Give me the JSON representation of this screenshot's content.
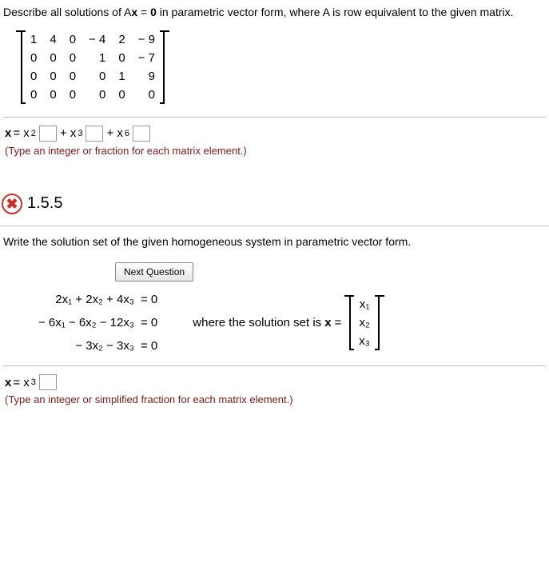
{
  "q1": {
    "prompt_pre": "Describe all solutions of A",
    "prompt_bold_x": "x",
    "prompt_eq": " = ",
    "prompt_bold_0": "0",
    "prompt_post": " in parametric vector form, where A is row equivalent to the given matrix.",
    "matrix": [
      [
        "1",
        "4",
        "0",
        "− 4",
        "2",
        "− 9"
      ],
      [
        "0",
        "0",
        "0",
        "1",
        "0",
        "− 7"
      ],
      [
        "0",
        "0",
        "0",
        "0",
        "1",
        "9"
      ],
      [
        "0",
        "0",
        "0",
        "0",
        "0",
        "0"
      ]
    ],
    "ans_x": "x",
    "ans_eq": " = x",
    "s2": "2",
    "plus": " + x",
    "s3": "3",
    "s6": "6",
    "instr": "(Type an integer or fraction for each matrix element.)"
  },
  "q2": {
    "icon_glyph": "✖",
    "num": "1.5.5",
    "prompt": "Write the solution set of the given homogeneous system in parametric vector form.",
    "next_btn": "Next Question",
    "eqs": [
      {
        "l": "2x₁ + 2x₂ + 4x₃",
        "r": "=  0"
      },
      {
        "l": "− 6x₁ − 6x₂ − 12x₃",
        "r": "=  0"
      },
      {
        "l": "− 3x₂ − 3x₃",
        "r": "=  0"
      }
    ],
    "where_pre": "where the solution set is ",
    "where_x": "x",
    "where_eq": " = ",
    "vec": [
      "x₁",
      "x₂",
      "x₃"
    ],
    "ans_x": "x",
    "ans_eq": " = x",
    "s3": "3",
    "instr": "(Type an integer or simplified fraction for each matrix element.)"
  }
}
